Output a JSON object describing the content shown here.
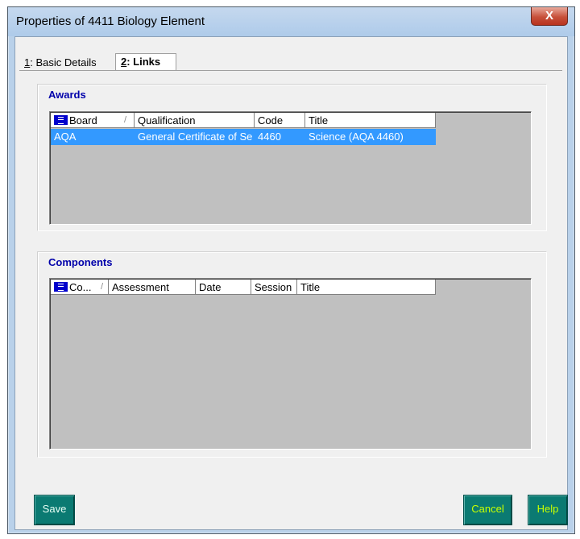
{
  "window": {
    "title": "Properties of 4411 Biology Element",
    "close_label": "X"
  },
  "tabs": [
    {
      "hotkey": "1",
      "label": ": Basic Details",
      "selected": false
    },
    {
      "hotkey": "2",
      "label": ": Links",
      "selected": true
    }
  ],
  "awards": {
    "title": "Awards",
    "columns": [
      "Board",
      "Qualification",
      "Code",
      "Title"
    ],
    "sort_indicator": "/",
    "rows": [
      {
        "board": "AQA",
        "qualification": "General Certificate of Se",
        "code": "4460",
        "title": "Science (AQA 4460)",
        "selected": true
      }
    ]
  },
  "components": {
    "title": "Components",
    "columns": [
      "Co...",
      "Assessment",
      "Date",
      "Session",
      "Title"
    ],
    "sort_indicator": "/",
    "rows": []
  },
  "buttons": {
    "save": "Save",
    "cancel": "Cancel",
    "help": "Help"
  },
  "colors": {
    "selection": "#3399ff",
    "button_bg": "#0b7a72",
    "button_text": "#c8ff00",
    "group_title": "#0000aa"
  }
}
